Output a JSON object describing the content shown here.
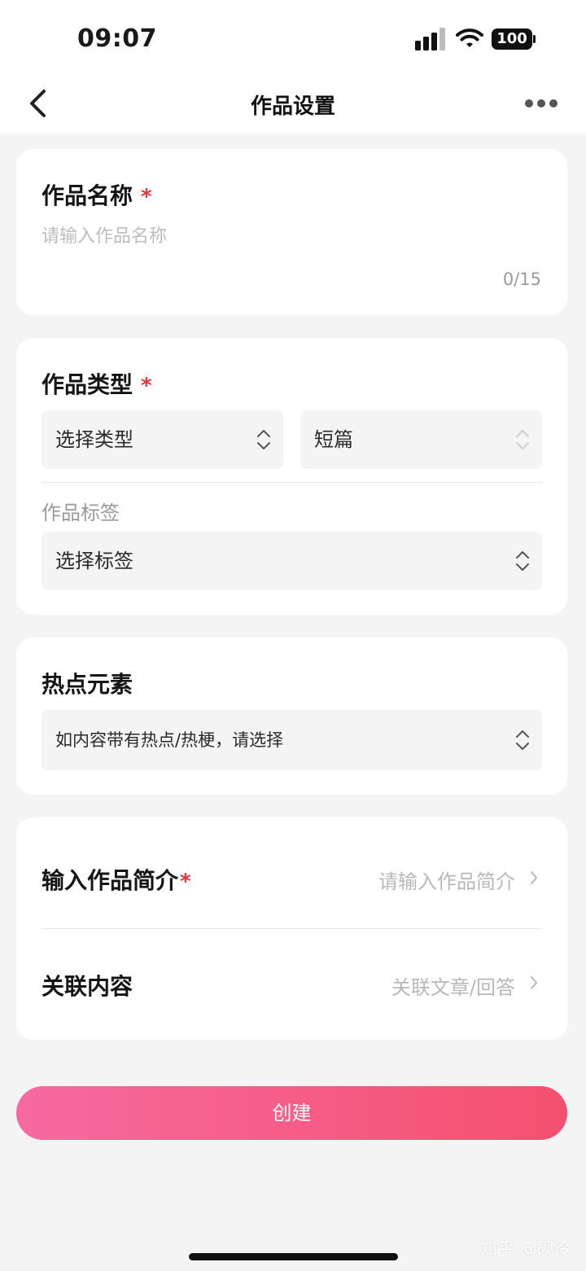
{
  "status_bar": {
    "time": "09:07",
    "battery": "100"
  },
  "nav": {
    "title": "作品设置",
    "back_icon": "chevron-left-icon",
    "more_icon": "more-dots-icon"
  },
  "name_card": {
    "label": "作品名称",
    "required": "*",
    "placeholder": "请输入作品名称",
    "counter": "0/15"
  },
  "type_card": {
    "label": "作品类型",
    "required": "*",
    "type_select": "选择类型",
    "length_select": "短篇",
    "tag_label": "作品标签",
    "tag_select": "选择标签"
  },
  "hot_card": {
    "label": "热点元素",
    "select": "如内容带有热点/热梗，请选择"
  },
  "intro_card": {
    "intro_label": "输入作品简介",
    "intro_required": "*",
    "intro_placeholder": "请输入作品简介",
    "related_label": "关联内容",
    "related_placeholder": "关联文章/回答"
  },
  "create_button": "创建",
  "watermark": "知乎 @砚泠",
  "colors": {
    "required": "#e8333f",
    "button_start": "#f76aa0",
    "button_end": "#f4506e"
  }
}
